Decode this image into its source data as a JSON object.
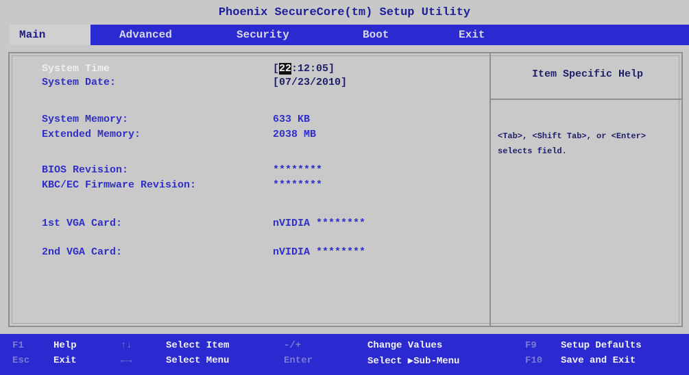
{
  "title": "Phoenix SecureCore(tm) Setup Utility",
  "menu": [
    "Main",
    "Advanced",
    "Security",
    "Boot",
    "Exit"
  ],
  "fields": [
    {
      "label": "System Time",
      "value_hl": "22",
      "value": ":12:05]",
      "value_prefix": "["
    },
    {
      "label": "System Date:",
      "value": "[07/23/2010]"
    },
    {
      "label": "System Memory:",
      "value": "633 KB"
    },
    {
      "label": "Extended Memory:",
      "value": "2038 MB"
    },
    {
      "label": "BIOS Revision:",
      "value": "********"
    },
    {
      "label": "KBC/EC Firmware Revision:",
      "value": "********"
    },
    {
      "label": "1st VGA Card:",
      "value": "nVIDIA ********"
    },
    {
      "label": "2nd VGA Card:",
      "value": "nVIDIA ********"
    }
  ],
  "help": {
    "title": "Item Specific Help",
    "text": "<Tab>, <Shift Tab>, or <Enter> selects field."
  },
  "footer": {
    "row1": [
      {
        "key": "F1",
        "desc": "Help"
      },
      {
        "key": "↑↓",
        "desc": "Select Item"
      },
      {
        "key": "-/+",
        "desc": "Change Values"
      },
      {
        "key": "F9",
        "desc": "Setup Defaults"
      }
    ],
    "row2": [
      {
        "key": "Esc",
        "desc": "Exit"
      },
      {
        "key": "←→",
        "desc": "Select Menu"
      },
      {
        "key": "Enter",
        "desc": "Select ▶Sub-Menu"
      },
      {
        "key": "F10",
        "desc": "Save and Exit"
      }
    ]
  },
  "colors": {
    "background": "#c8c8c8",
    "menubar": "#2a2ad0",
    "label_blue": "#2f2fc8",
    "value_navy": "#1d1d6a"
  }
}
